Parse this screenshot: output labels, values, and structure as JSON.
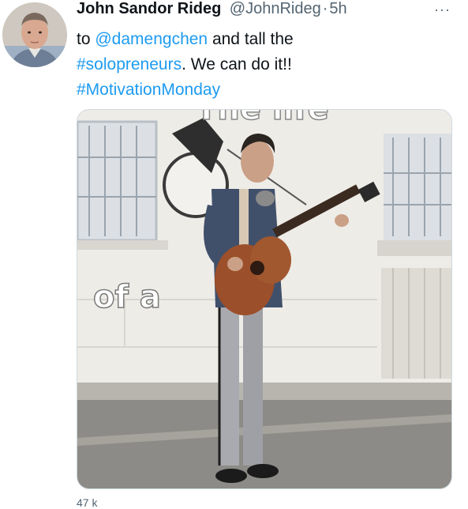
{
  "tweet": {
    "author_name": "John Sandor Rideg",
    "author_handle": "@JohnRideg",
    "separator": "·",
    "time": "5h",
    "more_label": "···",
    "text_parts": [
      {
        "text": "to ",
        "kind": "plain"
      },
      {
        "text": "@damengchen",
        "kind": "link"
      },
      {
        "text": " and tall the ",
        "kind": "plain"
      },
      {
        "text": "#solopreneurs",
        "kind": "link"
      },
      {
        "text": ". We can do it!! ",
        "kind": "plain"
      },
      {
        "text": "#MotivationMonday",
        "kind": "link"
      }
    ],
    "media_caption": "of a",
    "media_caption_top": "The life",
    "footer_partial": "47 k"
  },
  "colors": {
    "link": "#1d9bf0",
    "text": "#0f1419",
    "muted": "#536471"
  },
  "icons": {
    "more": "more-horizontal-icon"
  }
}
